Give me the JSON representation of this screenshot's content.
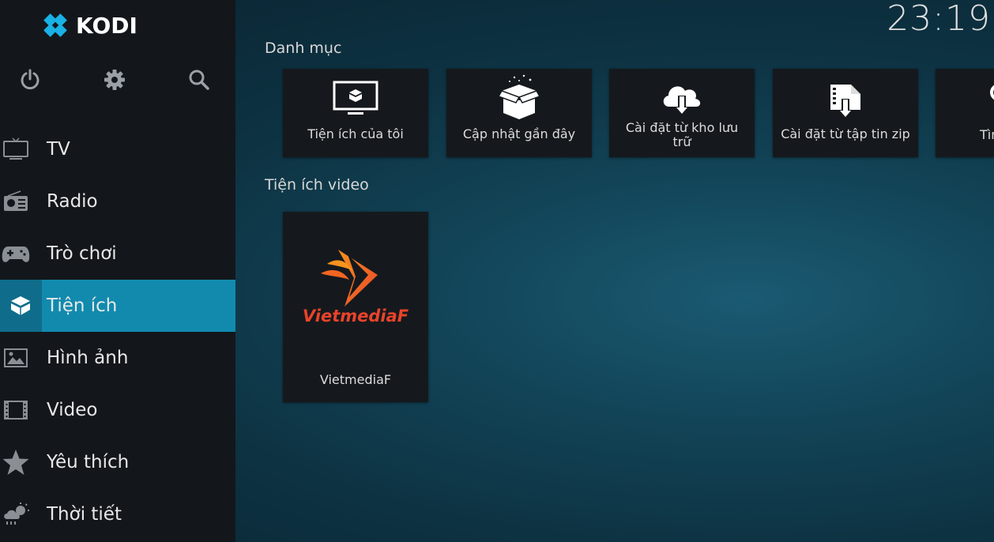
{
  "app": {
    "logo_text": "KODI",
    "clock": "23:19"
  },
  "top_icons": [
    {
      "name": "power-icon"
    },
    {
      "name": "gear-icon"
    },
    {
      "name": "search-icon"
    }
  ],
  "sidebar": {
    "items": [
      {
        "label": "TV",
        "icon": "tv-icon"
      },
      {
        "label": "Radio",
        "icon": "radio-icon"
      },
      {
        "label": "Trò chơi",
        "icon": "gamepad-icon"
      },
      {
        "label": "Tiện ích",
        "icon": "addons-box-icon",
        "active": true
      },
      {
        "label": "Hình ảnh",
        "icon": "picture-icon"
      },
      {
        "label": "Video",
        "icon": "film-icon"
      },
      {
        "label": "Yêu thích",
        "icon": "star-icon"
      },
      {
        "label": "Thời tiết",
        "icon": "weather-icon"
      }
    ]
  },
  "categories": {
    "title": "Danh mục",
    "tiles": [
      {
        "label": "Tiện ích của tôi",
        "icon": "monitor-box-icon"
      },
      {
        "label": "Cập nhật gần đây",
        "icon": "open-box-icon"
      },
      {
        "label": "Cài đặt từ kho lưu trữ",
        "icon": "cloud-download-icon"
      },
      {
        "label": "Cài đặt từ tập tin zip",
        "icon": "zip-download-icon"
      },
      {
        "label": "Tìm",
        "icon": "search-icon"
      }
    ]
  },
  "video_addons": {
    "title": "Tiện ích video",
    "tiles": [
      {
        "label": "VietmediaF",
        "logo_text": "VietmediaF",
        "icon": "vietmediaf-logo"
      }
    ]
  },
  "colors": {
    "accent": "#118aae",
    "sidebar_bg": "#13171b",
    "tile_bg": "#15191d",
    "logo_red": "#e8432a"
  }
}
